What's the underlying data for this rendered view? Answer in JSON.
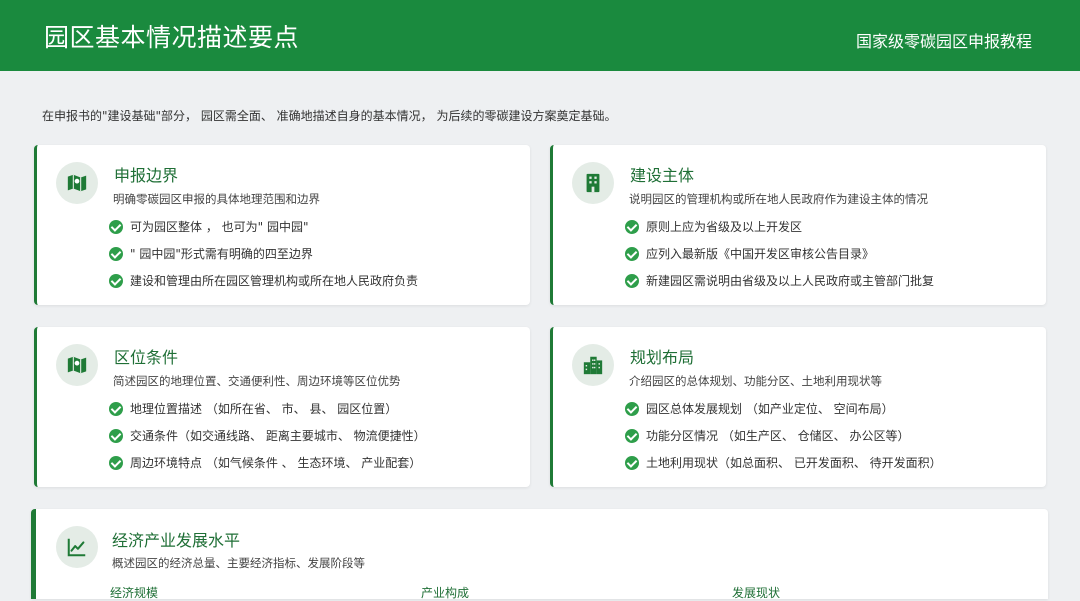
{
  "header": {
    "title": "园区基本情况描述要点",
    "subtitle": "国家级零碳园区申报教程"
  },
  "intro": "在申报书的\"建设基础\"部分， 园区需全面、 准确地描述自身的基本情况， 为后续的零碳建设方案奠定基础。",
  "cards": [
    {
      "icon": "map-icon",
      "title": "申报边界",
      "desc": "明确零碳园区申报的具体地理范围和边界",
      "items": [
        "可为园区整体 ， 也可为\" 园中园\"",
        "\" 园中园\"形式需有明确的四至边界",
        "建设和管理由所在园区管理机构或所在地人民政府负责"
      ]
    },
    {
      "icon": "building-icon",
      "title": "建设主体",
      "desc": "说明园区的管理机构或所在地人民政府作为建设主体的情况",
      "items": [
        "原则上应为省级及以上开发区",
        "应列入最新版《中国开发区审核公告目录》",
        "新建园区需说明由省级及以上人民政府或主管部门批复"
      ]
    },
    {
      "icon": "map-icon",
      "title": "区位条件",
      "desc": "简述园区的地理位置、交通便利性、周边环境等区位优势",
      "items": [
        "地理位置描述 （如所在省、 市、 县、 园区位置）",
        "交通条件（如交通线路、 距离主要城市、 物流便捷性）",
        "周边环境特点 （如气候条件 、 生态环境、 产业配套）"
      ]
    },
    {
      "icon": "city-icon",
      "title": "规划布局",
      "desc": "介绍园区的总体规划、功能分区、土地利用现状等",
      "items": [
        "园区总体发展规划 （如产业定位、 空间布局）",
        "功能分区情况 （如生产区、 仓储区、 办公区等）",
        "土地利用现状（如总面积、 已开发面积、 待开发面积）"
      ]
    }
  ],
  "economy": {
    "icon": "chart-line-icon",
    "title": "经济产业发展水平",
    "desc": "概述园区的经济总量、主要经济指标、发展阶段等",
    "columns": [
      "经济规模",
      "产业构成",
      "发展现状"
    ]
  },
  "colors": {
    "header_bg": "#1a8a3e",
    "accent": "#1f7a36",
    "check": "#2e9e4a"
  }
}
